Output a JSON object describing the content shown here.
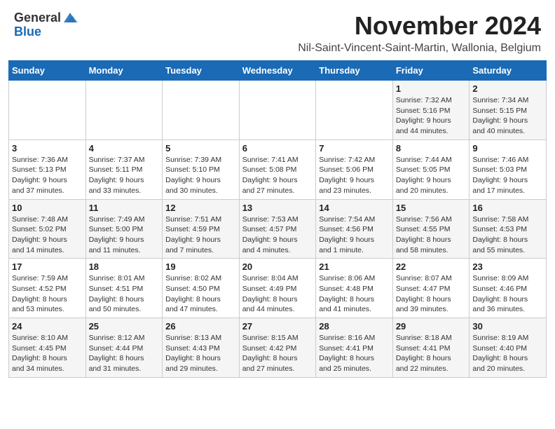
{
  "header": {
    "logo_general": "General",
    "logo_blue": "Blue",
    "month_title": "November 2024",
    "subtitle": "Nil-Saint-Vincent-Saint-Martin, Wallonia, Belgium"
  },
  "days_of_week": [
    "Sunday",
    "Monday",
    "Tuesday",
    "Wednesday",
    "Thursday",
    "Friday",
    "Saturday"
  ],
  "weeks": [
    [
      {
        "day": "",
        "info": ""
      },
      {
        "day": "",
        "info": ""
      },
      {
        "day": "",
        "info": ""
      },
      {
        "day": "",
        "info": ""
      },
      {
        "day": "",
        "info": ""
      },
      {
        "day": "1",
        "info": "Sunrise: 7:32 AM\nSunset: 5:16 PM\nDaylight: 9 hours\nand 44 minutes."
      },
      {
        "day": "2",
        "info": "Sunrise: 7:34 AM\nSunset: 5:15 PM\nDaylight: 9 hours\nand 40 minutes."
      }
    ],
    [
      {
        "day": "3",
        "info": "Sunrise: 7:36 AM\nSunset: 5:13 PM\nDaylight: 9 hours\nand 37 minutes."
      },
      {
        "day": "4",
        "info": "Sunrise: 7:37 AM\nSunset: 5:11 PM\nDaylight: 9 hours\nand 33 minutes."
      },
      {
        "day": "5",
        "info": "Sunrise: 7:39 AM\nSunset: 5:10 PM\nDaylight: 9 hours\nand 30 minutes."
      },
      {
        "day": "6",
        "info": "Sunrise: 7:41 AM\nSunset: 5:08 PM\nDaylight: 9 hours\nand 27 minutes."
      },
      {
        "day": "7",
        "info": "Sunrise: 7:42 AM\nSunset: 5:06 PM\nDaylight: 9 hours\nand 23 minutes."
      },
      {
        "day": "8",
        "info": "Sunrise: 7:44 AM\nSunset: 5:05 PM\nDaylight: 9 hours\nand 20 minutes."
      },
      {
        "day": "9",
        "info": "Sunrise: 7:46 AM\nSunset: 5:03 PM\nDaylight: 9 hours\nand 17 minutes."
      }
    ],
    [
      {
        "day": "10",
        "info": "Sunrise: 7:48 AM\nSunset: 5:02 PM\nDaylight: 9 hours\nand 14 minutes."
      },
      {
        "day": "11",
        "info": "Sunrise: 7:49 AM\nSunset: 5:00 PM\nDaylight: 9 hours\nand 11 minutes."
      },
      {
        "day": "12",
        "info": "Sunrise: 7:51 AM\nSunset: 4:59 PM\nDaylight: 9 hours\nand 7 minutes."
      },
      {
        "day": "13",
        "info": "Sunrise: 7:53 AM\nSunset: 4:57 PM\nDaylight: 9 hours\nand 4 minutes."
      },
      {
        "day": "14",
        "info": "Sunrise: 7:54 AM\nSunset: 4:56 PM\nDaylight: 9 hours\nand 1 minute."
      },
      {
        "day": "15",
        "info": "Sunrise: 7:56 AM\nSunset: 4:55 PM\nDaylight: 8 hours\nand 58 minutes."
      },
      {
        "day": "16",
        "info": "Sunrise: 7:58 AM\nSunset: 4:53 PM\nDaylight: 8 hours\nand 55 minutes."
      }
    ],
    [
      {
        "day": "17",
        "info": "Sunrise: 7:59 AM\nSunset: 4:52 PM\nDaylight: 8 hours\nand 53 minutes."
      },
      {
        "day": "18",
        "info": "Sunrise: 8:01 AM\nSunset: 4:51 PM\nDaylight: 8 hours\nand 50 minutes."
      },
      {
        "day": "19",
        "info": "Sunrise: 8:02 AM\nSunset: 4:50 PM\nDaylight: 8 hours\nand 47 minutes."
      },
      {
        "day": "20",
        "info": "Sunrise: 8:04 AM\nSunset: 4:49 PM\nDaylight: 8 hours\nand 44 minutes."
      },
      {
        "day": "21",
        "info": "Sunrise: 8:06 AM\nSunset: 4:48 PM\nDaylight: 8 hours\nand 41 minutes."
      },
      {
        "day": "22",
        "info": "Sunrise: 8:07 AM\nSunset: 4:47 PM\nDaylight: 8 hours\nand 39 minutes."
      },
      {
        "day": "23",
        "info": "Sunrise: 8:09 AM\nSunset: 4:46 PM\nDaylight: 8 hours\nand 36 minutes."
      }
    ],
    [
      {
        "day": "24",
        "info": "Sunrise: 8:10 AM\nSunset: 4:45 PM\nDaylight: 8 hours\nand 34 minutes."
      },
      {
        "day": "25",
        "info": "Sunrise: 8:12 AM\nSunset: 4:44 PM\nDaylight: 8 hours\nand 31 minutes."
      },
      {
        "day": "26",
        "info": "Sunrise: 8:13 AM\nSunset: 4:43 PM\nDaylight: 8 hours\nand 29 minutes."
      },
      {
        "day": "27",
        "info": "Sunrise: 8:15 AM\nSunset: 4:42 PM\nDaylight: 8 hours\nand 27 minutes."
      },
      {
        "day": "28",
        "info": "Sunrise: 8:16 AM\nSunset: 4:41 PM\nDaylight: 8 hours\nand 25 minutes."
      },
      {
        "day": "29",
        "info": "Sunrise: 8:18 AM\nSunset: 4:41 PM\nDaylight: 8 hours\nand 22 minutes."
      },
      {
        "day": "30",
        "info": "Sunrise: 8:19 AM\nSunset: 4:40 PM\nDaylight: 8 hours\nand 20 minutes."
      }
    ]
  ]
}
